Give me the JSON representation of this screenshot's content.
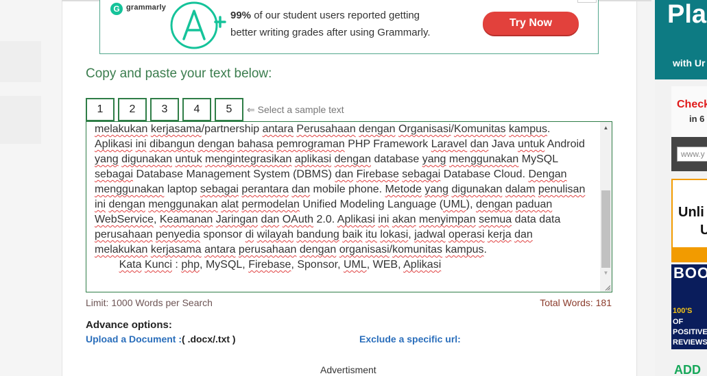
{
  "ad": {
    "brand": "grammarly",
    "logo_letter": "G",
    "grade": "A+",
    "stat": "99%",
    "line1": "of our student users reported getting",
    "line2": "better writing grades after using Grammarly.",
    "cta": "Try Now",
    "colors": {
      "brand_green": "#15c39a",
      "cta_red": "#e2413c"
    }
  },
  "checker": {
    "heading": "Copy and paste your text below:",
    "sample_buttons": [
      "1",
      "2",
      "3",
      "4",
      "5"
    ],
    "sample_hint": "⇐ Select a sample text",
    "text_lines": [
      "melakukan kerjasama/partnership antara Perusahaan dengan Organisasi/Komunitas kampus.",
      "Aplikasi ini dibangun dengan bahasa pemrograman PHP Framework Laravel dan Java untuk Android",
      "yang digunakan untuk mengintegrasikan aplikasi dengan database yang menggunakan MySQL",
      "sebagai Database Management System (DBMS) dan Firebase sebagai Database Cloud. Dengan",
      "menggunakan laptop sebagai perantara dan mobile phone. Metode yang digunakan dalam penulisan",
      "ini dengan menggunakan alat permodelan Unified Modeling Language (UML), dengan paduan",
      "WebService, Keamanan Jaringan dan OAuth 2.0. Aplikasi ini akan menyimpan semua data data",
      "perusahaan penyedia sponsor di wilayah bandung baik itu lokasi, jadwal operasi kerja  dan",
      "melakukan kerjasama antara perusahaan dengan organisasi/komunitas kampus.",
      "        Kata Kunci : php, MySQL, Firebase, Sponsor, UML, WEB, Aplikasi"
    ],
    "limit": "Limit: 1000 Words per Search",
    "total_words": "Total Words: 181",
    "advance_title": "Advance options:",
    "upload_label": "Upload a Document :",
    "upload_ext": "( .docx/.txt )",
    "exclude_label": "Exclude a specific url:",
    "advertisment": "Advertisment"
  },
  "side_ads": {
    "ad1_big": "Pla",
    "ad1_small": "with Ur",
    "ad2_red": "Check",
    "ad2_small": "in 6",
    "ad3_input": "www.y",
    "ad4_line1": "Unli",
    "ad4_line2": "U",
    "ad5_big": "BOOS",
    "ad5_line1": "100'S",
    "ad5_line2": "OF",
    "ad5_line3": "POSITIVE",
    "ad5_line4": "REVIEWS",
    "ad6": "ADD"
  }
}
